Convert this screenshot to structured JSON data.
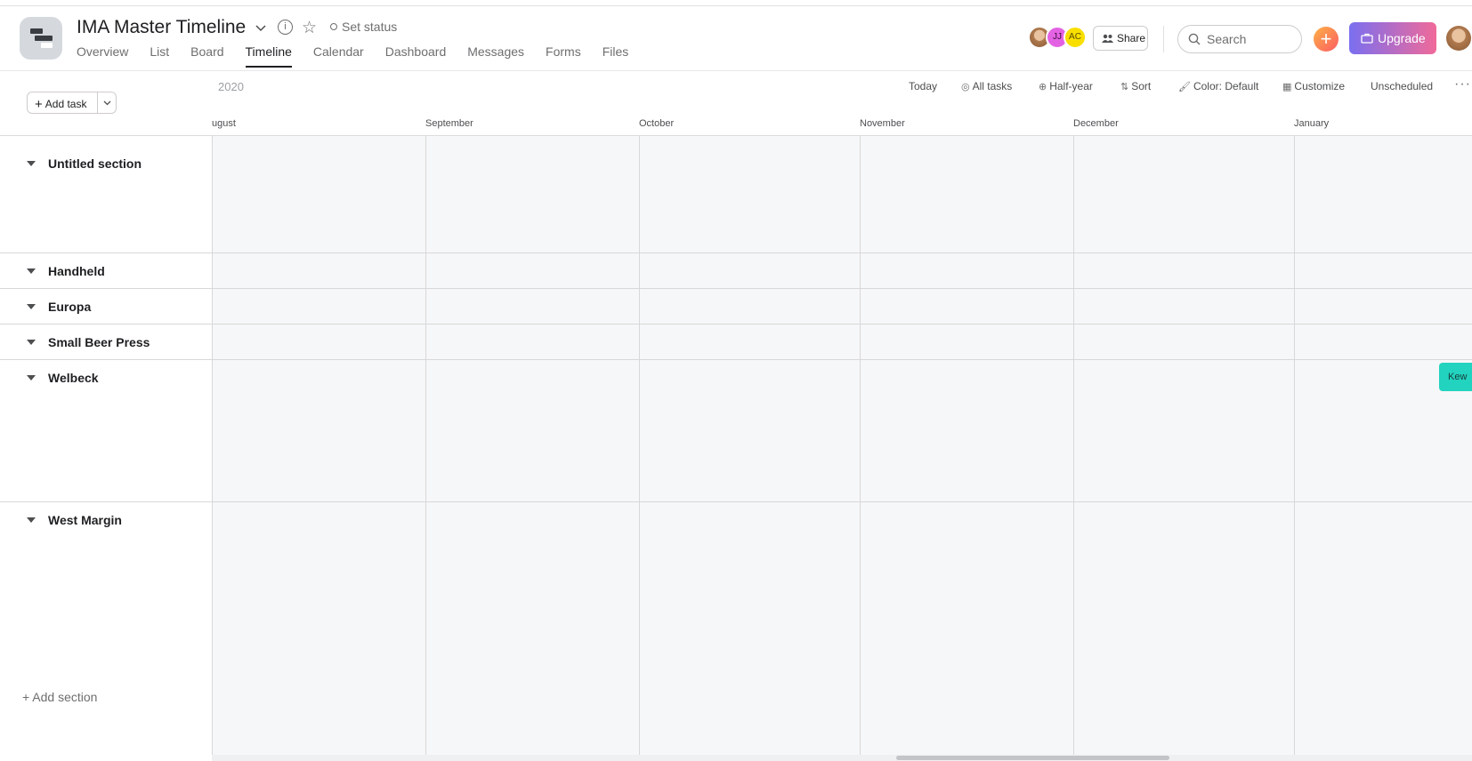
{
  "project": {
    "title": "IMA Master Timeline",
    "set_status": "Set status"
  },
  "tabs": [
    {
      "label": "Overview"
    },
    {
      "label": "List"
    },
    {
      "label": "Board"
    },
    {
      "label": "Timeline",
      "active": true
    },
    {
      "label": "Calendar"
    },
    {
      "label": "Dashboard"
    },
    {
      "label": "Messages"
    },
    {
      "label": "Forms"
    },
    {
      "label": "Files"
    }
  ],
  "header_right": {
    "avatars": [
      "",
      "JJ",
      "AC"
    ],
    "share_label": "Share",
    "search_placeholder": "Search",
    "upgrade_label": "Upgrade"
  },
  "toolbar": {
    "add_task_label": "Add task",
    "year": "2020",
    "today": "Today",
    "all_tasks": "All tasks",
    "half_year": "Half-year",
    "sort": "Sort",
    "color": "Color: Default",
    "customize": "Customize",
    "unscheduled": "Unscheduled"
  },
  "months": [
    "ugust",
    "September",
    "October",
    "November",
    "December",
    "January"
  ],
  "sections": [
    {
      "label": "Untitled section"
    },
    {
      "label": "Handheld"
    },
    {
      "label": "Europa"
    },
    {
      "label": "Small Beer Press"
    },
    {
      "label": "Welbeck"
    },
    {
      "label": "West Margin"
    }
  ],
  "add_section_label": "+ Add section",
  "tasks": [
    {
      "label": "Kew",
      "section": "Welbeck",
      "color": "#22d3bf"
    }
  ],
  "colors": {
    "accent_upgrade_start": "#7a6ff0",
    "accent_upgrade_end": "#f06a99",
    "grid_background": "#f6f7f8"
  }
}
